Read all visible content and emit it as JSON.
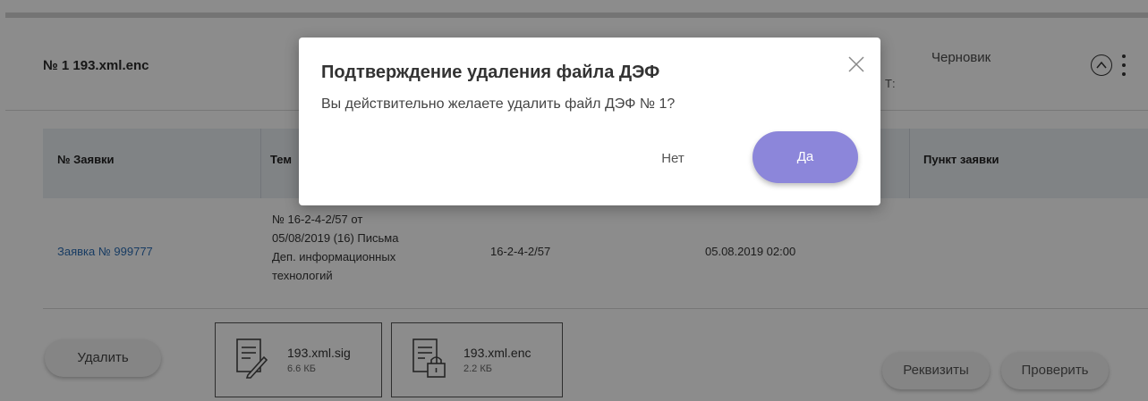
{
  "header": {
    "doc_title": "№ 1  193.xml.enc",
    "fragment": "Т:",
    "status": "Черновик",
    "icons": [
      "chevron-up-circle-icon",
      "more-vertical-icon"
    ]
  },
  "table": {
    "columns": [
      "№ Заявки",
      "Тем",
      "",
      "",
      "Пункт заявки"
    ],
    "row": {
      "request_link": "Заявка № 999777",
      "topic_lines": [
        "№ 16-2-4-2/57 от",
        "05/08/2019 (16) Письма",
        "Деп. информационных",
        "технологий"
      ],
      "number": "16-2-4-2/57",
      "date": "05.08.2019 02:00"
    }
  },
  "footer": {
    "delete_label": "Удалить",
    "files": [
      {
        "name": "193.xml.sig",
        "size": "6.6 КБ",
        "icon": "signed-document-icon"
      },
      {
        "name": "193.xml.enc",
        "size": "2.2 КБ",
        "icon": "locked-document-icon"
      }
    ],
    "requisites_label": "Реквизиты",
    "check_label": "Проверить"
  },
  "modal": {
    "title": "Подтверждение удаления файла ДЭФ",
    "message": "Вы действительно желаете удалить файл ДЭФ № 1?",
    "no_label": "Нет",
    "yes_label": "Да",
    "accent_color": "#8c86da"
  }
}
